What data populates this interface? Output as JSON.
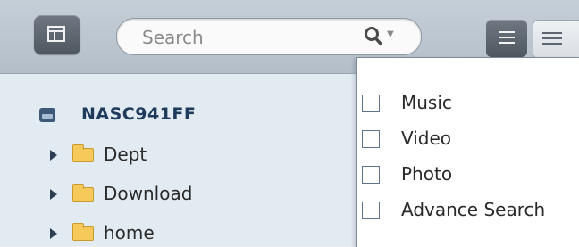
{
  "search": {
    "placeholder": "Search"
  },
  "tree": {
    "root_label": "NASC941FF",
    "folders": [
      {
        "label": "Dept"
      },
      {
        "label": "Download"
      },
      {
        "label": "home"
      }
    ]
  },
  "search_menu": {
    "options": [
      {
        "label": "Music"
      },
      {
        "label": "Video"
      },
      {
        "label": "Photo"
      },
      {
        "label": "Advance Search"
      }
    ]
  }
}
